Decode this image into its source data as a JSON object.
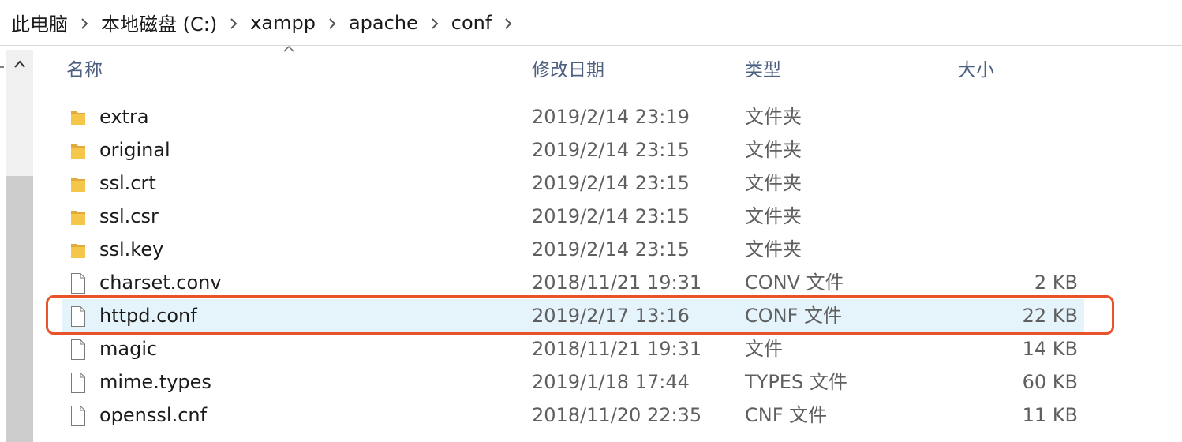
{
  "breadcrumb": {
    "items": [
      "此电脑",
      "本地磁盘 (C:)",
      "xampp",
      "apache",
      "conf"
    ]
  },
  "columns": {
    "name": "名称",
    "date": "修改日期",
    "type": "类型",
    "size": "大小"
  },
  "rows": [
    {
      "name": "extra",
      "date": "2019/2/14 23:19",
      "type": "文件夹",
      "size": "",
      "icon": "folder-icon"
    },
    {
      "name": "original",
      "date": "2019/2/14 23:15",
      "type": "文件夹",
      "size": "",
      "icon": "folder-icon"
    },
    {
      "name": "ssl.crt",
      "date": "2019/2/14 23:15",
      "type": "文件夹",
      "size": "",
      "icon": "folder-icon"
    },
    {
      "name": "ssl.csr",
      "date": "2019/2/14 23:15",
      "type": "文件夹",
      "size": "",
      "icon": "folder-icon"
    },
    {
      "name": "ssl.key",
      "date": "2019/2/14 23:15",
      "type": "文件夹",
      "size": "",
      "icon": "folder-icon"
    },
    {
      "name": "charset.conv",
      "date": "2018/11/21 19:31",
      "type": "CONV 文件",
      "size": "2 KB",
      "icon": "file-icon"
    },
    {
      "name": "httpd.conf",
      "date": "2019/2/17 13:16",
      "type": "CONF 文件",
      "size": "22 KB",
      "icon": "file-icon",
      "selected": true
    },
    {
      "name": "magic",
      "date": "2018/11/21 19:31",
      "type": "文件",
      "size": "14 KB",
      "icon": "file-icon"
    },
    {
      "name": "mime.types",
      "date": "2019/1/18 17:44",
      "type": "TYPES 文件",
      "size": "60 KB",
      "icon": "file-icon"
    },
    {
      "name": "openssl.cnf",
      "date": "2018/11/20 22:35",
      "type": "CNF 文件",
      "size": "11 KB",
      "icon": "file-icon"
    }
  ],
  "colors": {
    "selection": "#e5f3fb",
    "highlight": "#e8532b",
    "header_text": "#4d6082",
    "folder": "#f4c64a"
  }
}
